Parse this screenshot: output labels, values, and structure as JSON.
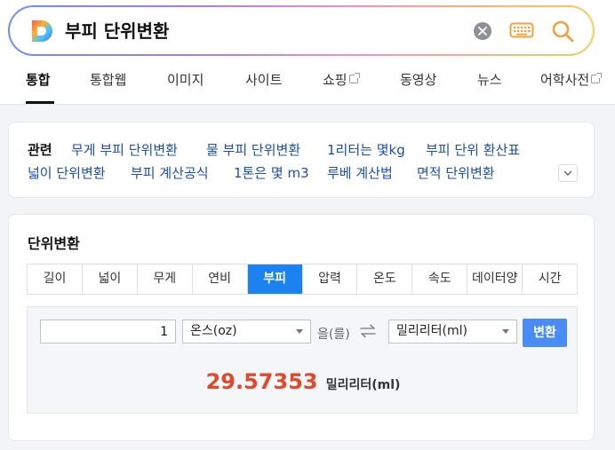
{
  "search": {
    "query": "부피 단위변환"
  },
  "tabs": [
    {
      "label": "통합",
      "active": true
    },
    {
      "label": "통합웹"
    },
    {
      "label": "이미지"
    },
    {
      "label": "사이트"
    },
    {
      "label": "쇼핑",
      "external": true
    },
    {
      "label": "동영상"
    },
    {
      "label": "뉴스"
    },
    {
      "label": "어학사전",
      "external": true
    }
  ],
  "related": {
    "title": "관련",
    "links": [
      "무게 부피 단위변환",
      "물 부피 단위변환",
      "1리터는 몇kg",
      "부피 단위 환산표",
      "넓이 단위변환",
      "부피 계산공식",
      "1톤은 몇 m3",
      "루베 계산법",
      "면적 단위변환"
    ]
  },
  "converter": {
    "title": "단위변환",
    "unit_tabs": [
      "길이",
      "넓이",
      "무게",
      "연비",
      "부피",
      "압력",
      "온도",
      "속도",
      "데이터양",
      "시간"
    ],
    "active_tab": "부피",
    "input_value": "1",
    "from_unit": "온스(oz)",
    "particle": "을(를)",
    "to_unit": "밀리리터(ml)",
    "convert_label": "변환",
    "result_value": "29.57353",
    "result_unit": "밀리리터(ml)"
  },
  "colors": {
    "accent": "#1b82f0",
    "result": "#e0492c",
    "link": "#1a4cc2",
    "button": "#4a8cf5"
  }
}
